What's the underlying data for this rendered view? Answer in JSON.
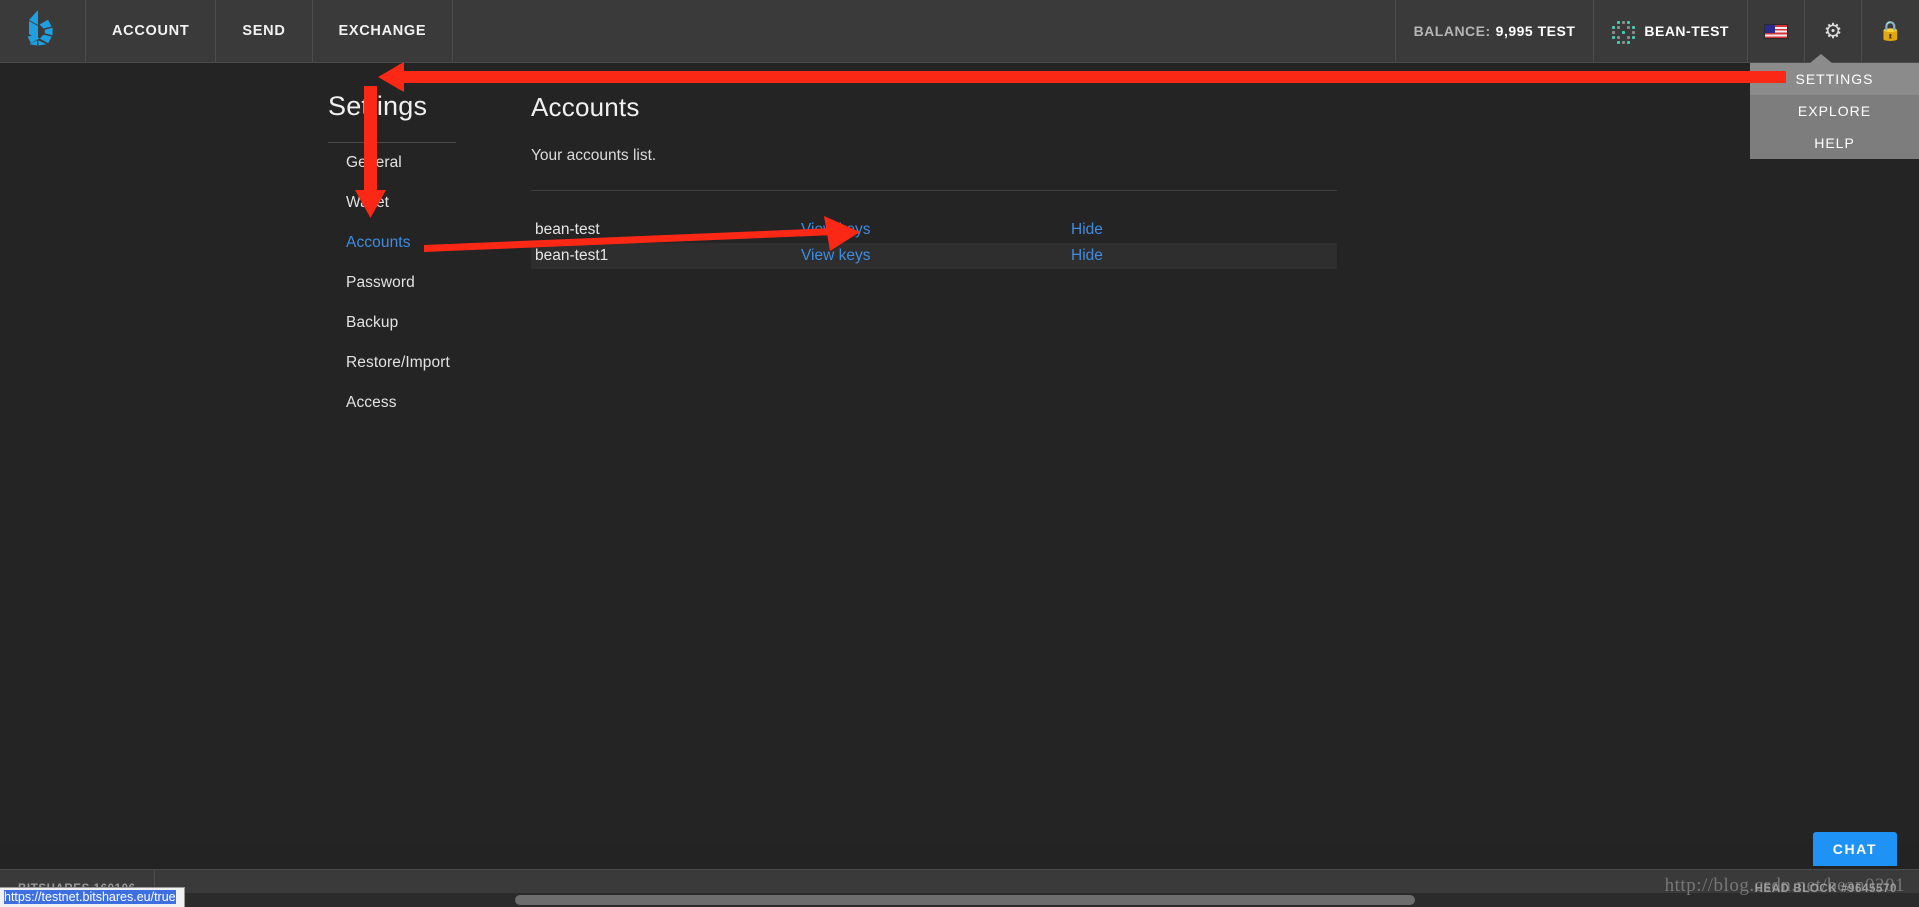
{
  "header": {
    "logo_icon": "bitshares-logo-icon",
    "nav": [
      {
        "label": "ACCOUNT"
      },
      {
        "label": "SEND"
      },
      {
        "label": "EXCHANGE"
      }
    ],
    "balance_label": "BALANCE:",
    "balance_value": "9,995 TEST",
    "account_name": "BEAN-TEST",
    "account_identicon": "identicon-icon",
    "locale_flag": "us-flag-icon",
    "settings_icon": "gear-icon",
    "lock_icon": "lock-icon",
    "gear_glyph": "⚙",
    "lock_glyph": "🔒"
  },
  "dropdown": {
    "items": [
      {
        "label": "SETTINGS",
        "active": true
      },
      {
        "label": "EXPLORE",
        "active": false
      },
      {
        "label": "HELP",
        "active": false
      }
    ]
  },
  "settings_sidebar": {
    "title": "Settings",
    "items": [
      {
        "label": "General",
        "active": false
      },
      {
        "label": "Wallet",
        "active": false
      },
      {
        "label": "Accounts",
        "active": true
      },
      {
        "label": "Password",
        "active": false
      },
      {
        "label": "Backup",
        "active": false
      },
      {
        "label": "Restore/Import",
        "active": false
      },
      {
        "label": "Access",
        "active": false
      }
    ]
  },
  "main": {
    "title": "Accounts",
    "subtitle": "Your accounts list.",
    "table": {
      "rows": [
        {
          "name": "bean-test",
          "keys_label": "View keys",
          "hide_label": "Hide"
        },
        {
          "name": "bean-test1",
          "keys_label": "View keys",
          "hide_label": "Hide"
        }
      ]
    }
  },
  "footer": {
    "version_label": "BITSHARES 160106",
    "head_block_label": "HEAD BLOCK #9645570"
  },
  "chat": {
    "label": "CHAT"
  },
  "status_tip": {
    "url": "https://testnet.bitshares.eu/true"
  },
  "watermark": {
    "text": "http://blog.csdn.net/bean0201"
  },
  "colors": {
    "accent_link": "#3f8ce0",
    "brand_blue": "#1f92f5",
    "annotation_red": "#fa2814",
    "header_bg": "#3a3a3a",
    "page_bg": "#242424",
    "dropdown_bg": "#7d7d7d"
  }
}
